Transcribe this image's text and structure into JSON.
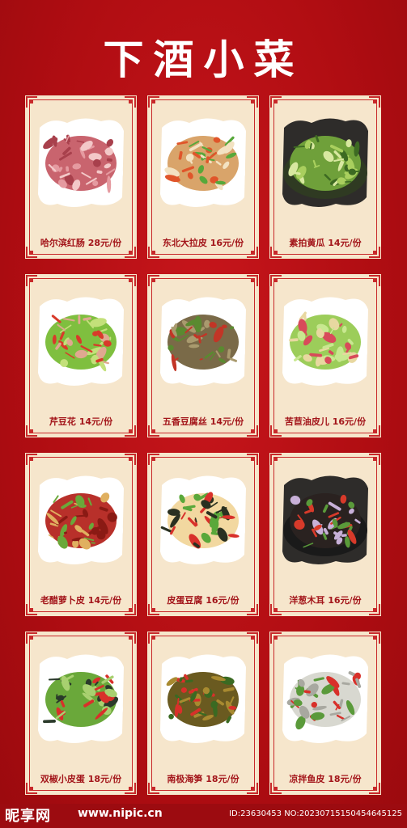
{
  "page": {
    "title": "下酒小菜"
  },
  "menu": {
    "items": [
      {
        "name": "哈尔滨红肠",
        "price": "28元/份",
        "label": "哈尔滨红肠  28元/份",
        "theme": "sausage"
      },
      {
        "name": "东北大拉皮",
        "price": "16元/份",
        "label": "东北大拉皮  16元/份",
        "theme": "noodle"
      },
      {
        "name": "素拍黄瓜",
        "price": "14元/份",
        "label": "素拍黄瓜  14元/份",
        "theme": "cucumber"
      },
      {
        "name": "芹豆花",
        "price": "14元/份",
        "label": "芹豆花  14元/份",
        "theme": "celery"
      },
      {
        "name": "五香豆腐丝",
        "price": "14元/份",
        "label": "五香豆腐丝  14元/份",
        "theme": "tofu"
      },
      {
        "name": "苦苣油皮儿",
        "price": "16元/份",
        "label": "苦苣油皮儿  16元/份",
        "theme": "endive"
      },
      {
        "name": "老醋萝卜皮",
        "price": "14元/份",
        "label": "老醋萝卜皮  14元/份",
        "theme": "radish"
      },
      {
        "name": "皮蛋豆腐",
        "price": "16元/份",
        "label": "皮蛋豆腐  16元/份",
        "theme": "egg"
      },
      {
        "name": "洋葱木耳",
        "price": "16元/份",
        "label": "洋葱木耳  16元/份",
        "theme": "fungus"
      },
      {
        "name": "双椒小皮蛋",
        "price": "18元/份",
        "label": "双椒小皮蛋  18元/份",
        "theme": "pepper"
      },
      {
        "name": "南极海笋",
        "price": "18元/份",
        "label": "南极海笋  18元/份",
        "theme": "bamboo"
      },
      {
        "name": "凉拌鱼皮",
        "price": "18元/份",
        "label": "凉拌鱼皮  18元/份",
        "theme": "fish"
      }
    ]
  },
  "footer": {
    "logo": "昵享网",
    "url": "www.nipic.cn",
    "id_text": "ID:23630453 NO:20230715150454645125"
  },
  "colors": {
    "background": "#b80e14",
    "card": "#f6e6cc",
    "label": "#a3151a"
  }
}
